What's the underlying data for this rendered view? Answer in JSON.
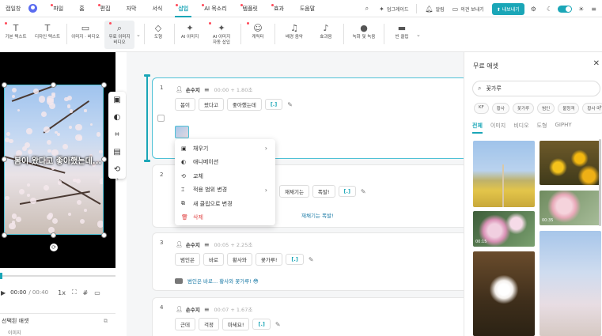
{
  "topbar": {
    "brand": "캡일창",
    "menu": [
      {
        "label": "파일",
        "dot": true,
        "active": false
      },
      {
        "label": "홈",
        "dot": false,
        "active": false
      },
      {
        "label": "편집",
        "dot": true,
        "active": false
      },
      {
        "label": "자막",
        "dot": false,
        "active": false
      },
      {
        "label": "서식",
        "dot": false,
        "active": false
      },
      {
        "label": "삽입",
        "dot": true,
        "active": true
      },
      {
        "label": "AI 목소리",
        "dot": true,
        "active": false
      },
      {
        "label": "템플릿",
        "dot": true,
        "active": false
      },
      {
        "label": "효과",
        "dot": true,
        "active": false
      },
      {
        "label": "도움말",
        "dot": false,
        "active": false
      }
    ],
    "upgrade": "업그레이드",
    "notice": "알림",
    "feedback": "의견 보내기",
    "export": "내보내기"
  },
  "toolbar": {
    "tools": [
      {
        "label": "기본 텍스트",
        "icon": "T",
        "dot": true
      },
      {
        "label": "디자인 텍스트",
        "icon": "T",
        "dot": false
      },
      {
        "label": "이미지 · 비디오",
        "icon": "▭",
        "dot": false
      },
      {
        "label": "무료 이미지\n비디오",
        "icon": "⌕",
        "dot": true
      },
      {
        "label": "도형",
        "icon": "◇",
        "dot": false
      },
      {
        "label": "AI 이미지",
        "icon": "✦",
        "dot": false
      },
      {
        "label": "AI 이미지\n자동 삽입",
        "icon": "✦",
        "dot": true
      },
      {
        "label": "캐릭터",
        "icon": "☺",
        "dot": true
      },
      {
        "label": "배경 음악",
        "icon": "♫",
        "dot": false
      },
      {
        "label": "효과음",
        "icon": "♪",
        "dot": false
      },
      {
        "label": "녹화 및 녹음",
        "icon": "●",
        "dot": false
      },
      {
        "label": "빈 클립",
        "icon": "▬",
        "dot": false
      }
    ]
  },
  "preview": {
    "caption": "봄이 왔다고 좋아했는데...",
    "time_current": "00:00",
    "time_total": "/ 00:40",
    "speed": "1x",
    "progress": 0.01,
    "assets_title": "선택된 애셋",
    "assets_item": "이미지"
  },
  "context_menu": [
    {
      "label": "채우기",
      "icon": "▣",
      "arrow": true,
      "danger": false
    },
    {
      "label": "애니메이션",
      "icon": "◐",
      "arrow": false,
      "danger": false
    },
    {
      "label": "교체",
      "icon": "⟲",
      "arrow": false,
      "danger": false
    },
    {
      "label": "적용 범위 변경",
      "icon": "⌶",
      "arrow": true,
      "danger": false
    },
    {
      "label": "새 클립으로 변경",
      "icon": "⧉",
      "arrow": false,
      "danger": false
    },
    {
      "label": "삭제",
      "icon": "🗑",
      "arrow": false,
      "danger": true
    }
  ],
  "scenes": [
    {
      "num": "1",
      "speaker": "손수지",
      "time": "00:00 + 1.80초",
      "words": [
        "봄이",
        "왔다고",
        "좋아했는데",
        "[.]"
      ],
      "subtitle": ""
    },
    {
      "num": "2",
      "speaker": "손수지",
      "time": "",
      "words": [
        "재채기는",
        "폭발!",
        "[.]"
      ],
      "subtitle": "재채기는 폭발!"
    },
    {
      "num": "3",
      "speaker": "손수지",
      "time": "00:05 + 2.25초",
      "words": [
        "범인은",
        "바로",
        "황사와",
        "꽃가루!",
        "[.]"
      ],
      "subtitle": "범인은 바로... 황사와 꽃가루! 😳"
    },
    {
      "num": "4",
      "speaker": "손수지",
      "time": "00:07 + 1.67초",
      "words": [
        "근데",
        "걱정",
        "마세요!",
        "[.]"
      ],
      "subtitle": ""
    }
  ],
  "panel": {
    "title": "무료 애셋",
    "search_value": "꽃가루",
    "chips": [
      "KF",
      "황사",
      "꽃가루",
      "범인",
      "불청객",
      "황사 마"
    ],
    "tabs": [
      "전체",
      "이미지",
      "비디오",
      "도형",
      "GIPHY"
    ],
    "badges": [
      "00:35",
      "00:15"
    ]
  }
}
